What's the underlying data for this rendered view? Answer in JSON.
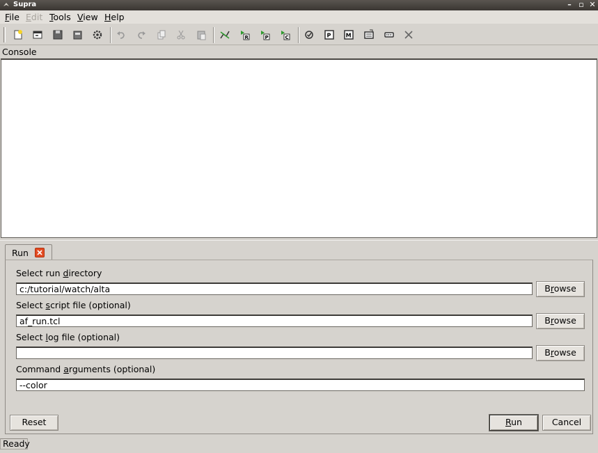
{
  "window": {
    "title": "Supra"
  },
  "menu": {
    "file": "File",
    "edit": "Edit",
    "tools": "Tools",
    "view": "View",
    "help": "Help"
  },
  "toolbar": {
    "icons": [
      "new-file-icon",
      "open-icon",
      "save-icon",
      "save-all-icon",
      "settings-icon",
      "undo-icon",
      "redo-icon",
      "copy-icon",
      "cut-icon",
      "paste-icon",
      "graph-icon",
      "run-r-icon",
      "run-p-icon",
      "run-c-icon",
      "check-icon",
      "panel-p-icon",
      "panel-m-icon",
      "edit-panel-icon",
      "terminal-icon",
      "clear-icon"
    ]
  },
  "console": {
    "label": "Console",
    "content": ""
  },
  "tabs": {
    "run": {
      "label": "Run"
    }
  },
  "form": {
    "run_dir": {
      "label": "Select run directory",
      "value": "c:/tutorial/watch/alta",
      "browse": "Browse"
    },
    "script_file": {
      "label": "Select script file (optional)",
      "value": "af_run.tcl",
      "browse": "Browse"
    },
    "log_file": {
      "label": "Select log file (optional)",
      "value": "",
      "browse": "Browse"
    },
    "args": {
      "label": "Command arguments (optional)",
      "value": "--color"
    }
  },
  "buttons": {
    "reset": "Reset",
    "run": "Run",
    "cancel": "Cancel"
  },
  "status": {
    "text": "Ready"
  },
  "colors": {
    "close_tab": "#e24b22",
    "run_icon_green": "#2e9a2e",
    "background": "#d6d3ce"
  }
}
